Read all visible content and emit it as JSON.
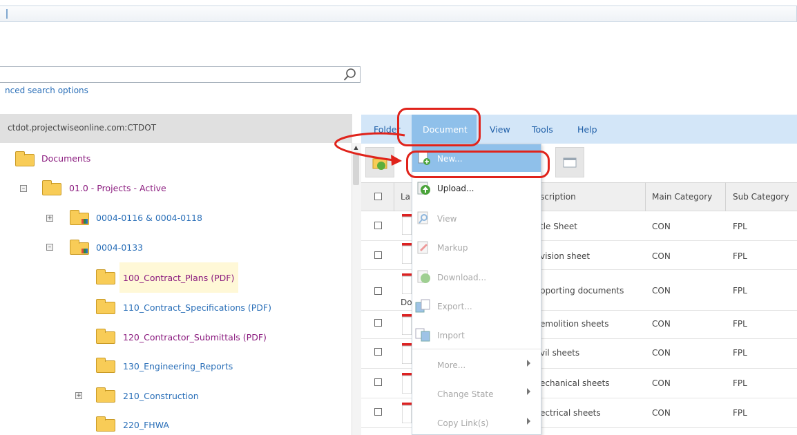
{
  "search": {
    "advanced_link": "nced search options"
  },
  "tree": {
    "header": "ctdot.projectwiseonline.com:CTDOT",
    "items": [
      {
        "label": "Documents"
      },
      {
        "label": "01.0 - Projects - Active"
      },
      {
        "label": "0004-0116 & 0004-0118"
      },
      {
        "label": "0004-0133"
      },
      {
        "label": "100_Contract_Plans (PDF)"
      },
      {
        "label": "110_Contract_Specifications (PDF)"
      },
      {
        "label": "120_Contractor_Submittals (PDF)"
      },
      {
        "label": "130_Engineering_Reports"
      },
      {
        "label": "210_Construction"
      },
      {
        "label": "220_FHWA"
      }
    ]
  },
  "menubar": {
    "folder": "Folder",
    "document": "Document",
    "view": "View",
    "tools": "Tools",
    "help": "Help"
  },
  "grid": {
    "col_label": "La",
    "col_description": "scription",
    "col_main_category": "Main Category",
    "col_sub_category": "Sub Category",
    "partial_text": "Do",
    "rows": [
      {
        "description": "tle Sheet",
        "main": "CON",
        "sub": "FPL"
      },
      {
        "description": "vision sheet",
        "main": "CON",
        "sub": "FPL"
      },
      {
        "description": "pporting documents",
        "main": "CON",
        "sub": "FPL"
      },
      {
        "description": "emolition sheets",
        "main": "CON",
        "sub": "FPL"
      },
      {
        "description": "vil sheets",
        "main": "CON",
        "sub": "FPL"
      },
      {
        "description": "echanical sheets",
        "main": "CON",
        "sub": "FPL"
      },
      {
        "description": "ectrical sheets",
        "main": "CON",
        "sub": "FPL"
      }
    ]
  },
  "dropdown": {
    "new": "New...",
    "upload": "Upload...",
    "view": "View",
    "markup": "Markup",
    "download": "Download...",
    "export": "Export...",
    "import": "Import",
    "more": "More...",
    "change_state": "Change State",
    "copy_links": "Copy Link(s)"
  },
  "colors": {
    "accent": "#8fc0ea",
    "menubar": "#d3e6f8",
    "annotation": "#e0231b",
    "link": "#2a6fb8",
    "folder_purple": "#8a1a7e"
  }
}
